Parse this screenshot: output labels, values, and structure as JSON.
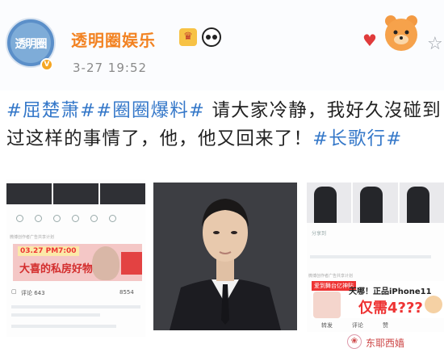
{
  "post": {
    "username": "透明圈娱乐",
    "avatar_text": "透明圈",
    "timestamp": "3-27  19:52",
    "text_parts": [
      {
        "text": "#屈楚萧##圈圈爆料#",
        "kind": "tag"
      },
      {
        "text": " 请大家冷静，我好久沒碰到过这样的事情了，他，他又回来了！",
        "kind": "plain"
      },
      {
        "text": "#长歌行#",
        "kind": "tag"
      }
    ]
  },
  "left_screenshot": {
    "ad_label": "微博创作者广告共享计划",
    "ad_price": "03.27 PM7:00",
    "ad_text": "大喜的私房好物",
    "comment_label": "评论 643",
    "count_label": "8554"
  },
  "right_screenshot": {
    "share_label": "分享到",
    "ad_label": "微博创作者广告共享计划",
    "ad_tag": "爱到舞台亿神贴",
    "ad_line1": "天哪！正品iPhone11",
    "ad_line2": "仅需4???",
    "bottom_left": "转发",
    "bottom_mid": "评论",
    "bottom_right": "赞"
  },
  "watermark": {
    "text": "东耶西嫱"
  },
  "colors": {
    "username": "#f28221",
    "tag": "#3578c9",
    "timestamp": "#8a8a8a"
  }
}
